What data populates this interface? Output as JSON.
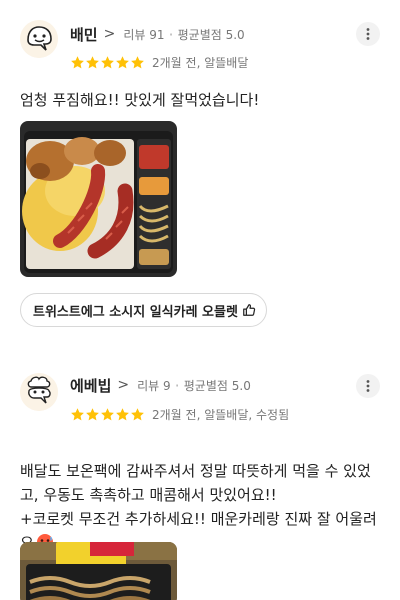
{
  "reviews": [
    {
      "user_name": "배민",
      "chevron": ">",
      "review_count": "리뷰 91",
      "avg_rating": "평균별점 5.0",
      "rating": 5,
      "date_info": "2개월 전, 알뜰배달",
      "text": "엄청 푸짐해요!! 맛있게 잘먹었습니다!",
      "menu_chip": "트위스트에그 소시지 일식카레 오믈렛",
      "icons": {
        "avatar": "smiling-face-avatar-icon",
        "more": "more-vertical-icon",
        "like": "thumbs-up-icon"
      }
    },
    {
      "user_name": "에베빕",
      "chevron": ">",
      "review_count": "리뷰 9",
      "avg_rating": "평균별점 5.0",
      "rating": 5,
      "date_info": "2개월 전, 알뜰배달, 수정됨",
      "text": "배달도 보온팩에 감싸주셔서 정말 따뜻하게 먹을 수 있었고, 우동도 촉촉하고 매콤해서 맛있어요!!\n+코로켓 무조건 추가하세요!! 매운카레랑 진짜 잘 어울려요",
      "emoji": "hot-face-emoji",
      "icons": {
        "avatar": "chef-face-avatar-icon",
        "more": "more-vertical-icon"
      }
    }
  ],
  "colors": {
    "star": "#ffc107",
    "meta": "#777777",
    "chip_border": "#d8d8d8"
  }
}
